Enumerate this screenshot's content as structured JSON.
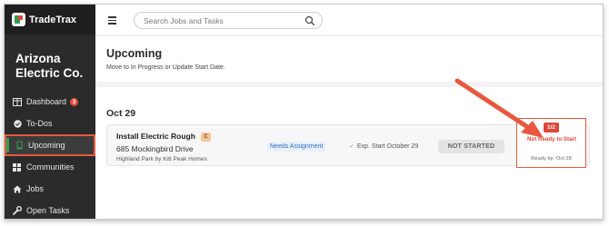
{
  "app": {
    "name": "TradeTrax",
    "company": "Arizona Electric Co."
  },
  "sidebar": {
    "items": [
      {
        "label": "Dashboard",
        "icon": "dashboard-icon",
        "badge": "3"
      },
      {
        "label": "To-Dos",
        "icon": "check-circle-icon"
      },
      {
        "label": "Upcoming",
        "icon": "mobile-icon",
        "active": true
      },
      {
        "label": "Communities",
        "icon": "grid-icon"
      },
      {
        "label": "Jobs",
        "icon": "home-icon"
      },
      {
        "label": "Open Tasks",
        "icon": "wrench-icon"
      }
    ]
  },
  "topbar": {
    "search_placeholder": "Search Jobs and Tasks"
  },
  "main": {
    "title": "Upcoming",
    "subtitle": "Move to In Progress or Update Start Date.",
    "date_heading": "Oct 29",
    "task": {
      "title": "Install Electric Rough",
      "badge": "C",
      "address": "685 Mockingbird Drive",
      "meta": "Highland Park by Kitt Peak Homes",
      "assignment": "Needs Assignment",
      "expected_start": "Exp. Start October 29",
      "status": "NOT STARTED",
      "ready_count": "1/2",
      "ready_status": "Not Ready to Start",
      "ready_by": "Ready by: Oct 28"
    }
  },
  "colors": {
    "accent": "#2fa14e",
    "annotation": "#e8583e",
    "alert": "#e0473a"
  }
}
